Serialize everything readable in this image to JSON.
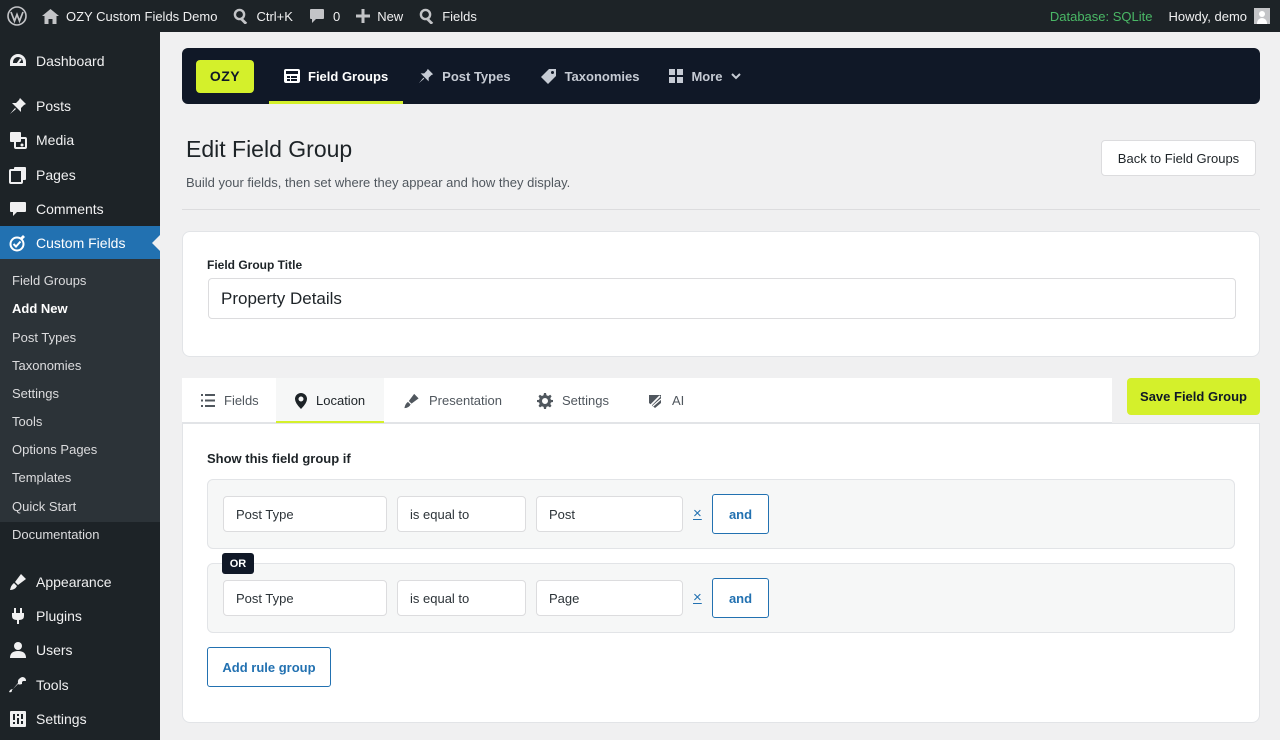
{
  "admin_bar": {
    "wp_icon": "wordpress-icon",
    "site_name": "OZY Custom Fields Demo",
    "shortcut": "Ctrl+K",
    "comments_count": "0",
    "new_label": "New",
    "fields_label": "Fields",
    "db_status": "Database: SQLite",
    "greeting": "Howdy, demo"
  },
  "sidebar": {
    "menu": [
      {
        "label": "Dashboard",
        "icon": "dashboard-icon"
      },
      {
        "label": "Posts",
        "icon": "pushpin-icon"
      },
      {
        "label": "Media",
        "icon": "media-icon"
      },
      {
        "label": "Pages",
        "icon": "pages-icon"
      },
      {
        "label": "Comments",
        "icon": "comment-icon"
      },
      {
        "label": "Custom Fields",
        "icon": "custom-fields-icon"
      },
      {
        "label": "Appearance",
        "icon": "brush-icon"
      },
      {
        "label": "Plugins",
        "icon": "plugin-icon"
      },
      {
        "label": "Users",
        "icon": "user-icon"
      },
      {
        "label": "Tools",
        "icon": "wrench-icon"
      },
      {
        "label": "Settings",
        "icon": "settings-icon"
      }
    ],
    "submenu": [
      "Field Groups",
      "Add New",
      "Post Types",
      "Taxonomies",
      "Settings",
      "Tools",
      "Options Pages",
      "Templates",
      "Quick Start",
      "Documentation"
    ],
    "active_submenu": "Add New"
  },
  "top_nav": {
    "logo": "OZY",
    "tabs": [
      {
        "label": "Field Groups",
        "icon": "field-groups-icon",
        "active": true
      },
      {
        "label": "Post Types",
        "icon": "pushpin-icon"
      },
      {
        "label": "Taxonomies",
        "icon": "tag-icon"
      },
      {
        "label": "More",
        "icon": "grid-icon"
      }
    ]
  },
  "header": {
    "title": "Edit Field Group",
    "subtitle": "Build your fields, then set where they appear and how they display.",
    "back_button": "Back to Field Groups"
  },
  "title_card": {
    "label": "Field Group Title",
    "value": "Property Details"
  },
  "content_tabs": [
    {
      "label": "Fields",
      "icon": "list-icon"
    },
    {
      "label": "Location",
      "icon": "location-pin-icon",
      "active": true
    },
    {
      "label": "Presentation",
      "icon": "brush-icon"
    },
    {
      "label": "Settings",
      "icon": "gear-icon"
    },
    {
      "label": "AI",
      "icon": "ai-icon"
    }
  ],
  "save_button": "Save Field Group",
  "location": {
    "heading": "Show this field group if",
    "groups": [
      {
        "param": "Post Type",
        "operator": "is equal to",
        "value": "Post",
        "remove": "×",
        "and_label": "and"
      },
      {
        "param": "Post Type",
        "operator": "is equal to",
        "value": "Page",
        "remove": "×",
        "and_label": "and"
      }
    ],
    "or_label": "OR",
    "add_rule_group": "Add rule group"
  },
  "colors": {
    "accent": "#d4f02b",
    "nav_bg": "#101827",
    "wp_blue": "#2271b1",
    "db_green": "#4ab866"
  }
}
